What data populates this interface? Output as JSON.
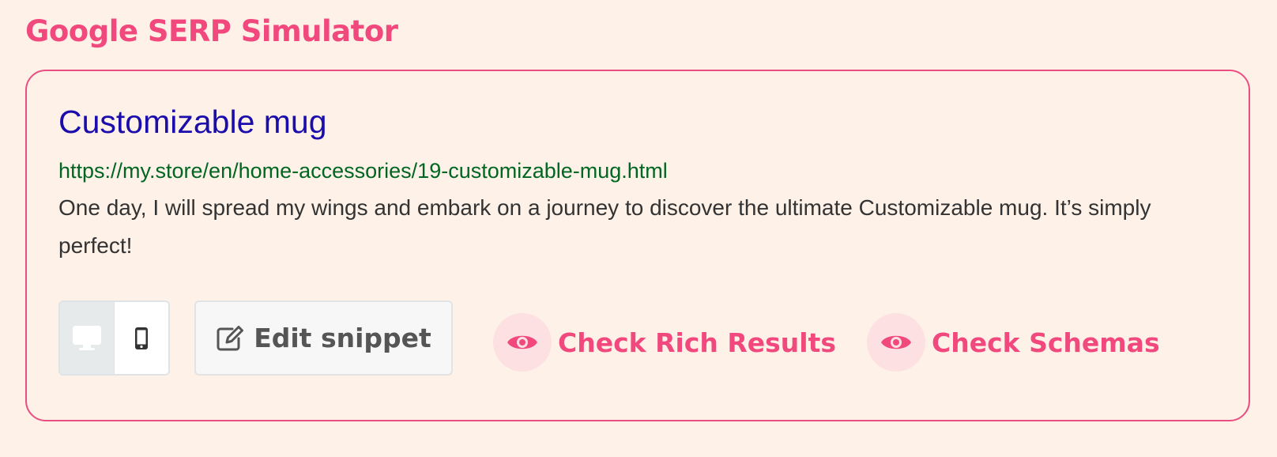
{
  "app": {
    "title": "Google SERP Simulator"
  },
  "serp": {
    "title": "Customizable mug",
    "url": "https://my.store/en/home-accessories/19-customizable-mug.html",
    "description": "One day, I will spread my wings and embark on a journey to discover the ultimate Customizable mug. It’s simply perfect!"
  },
  "controls": {
    "device_toggle": {
      "options": [
        {
          "name": "desktop",
          "icon": "desktop-icon",
          "active": true
        },
        {
          "name": "mobile",
          "icon": "mobile-icon",
          "active": false
        }
      ]
    },
    "edit_snippet": {
      "label": "Edit snippet",
      "icon": "edit-icon"
    },
    "check_rich_results": {
      "label": "Check Rich Results",
      "icon": "eye-icon"
    },
    "check_schemas": {
      "label": "Check Schemas",
      "icon": "eye-icon"
    }
  },
  "colors": {
    "accent": "#f1497d",
    "title_link": "#1a0dab",
    "url": "#006621",
    "background": "#fef1e8"
  }
}
